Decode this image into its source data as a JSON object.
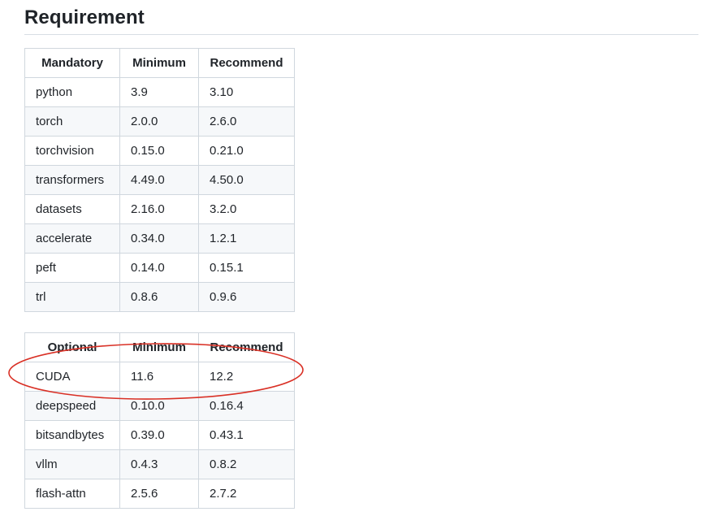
{
  "heading": "Requirement",
  "mandatory": {
    "headers": [
      "Mandatory",
      "Minimum",
      "Recommend"
    ],
    "rows": [
      [
        "python",
        "3.9",
        "3.10"
      ],
      [
        "torch",
        "2.0.0",
        "2.6.0"
      ],
      [
        "torchvision",
        "0.15.0",
        "0.21.0"
      ],
      [
        "transformers",
        "4.49.0",
        "4.50.0"
      ],
      [
        "datasets",
        "2.16.0",
        "3.2.0"
      ],
      [
        "accelerate",
        "0.34.0",
        "1.2.1"
      ],
      [
        "peft",
        "0.14.0",
        "0.15.1"
      ],
      [
        "trl",
        "0.8.6",
        "0.9.6"
      ]
    ]
  },
  "optional": {
    "headers": [
      "Optional",
      "Minimum",
      "Recommend"
    ],
    "rows": [
      [
        "CUDA",
        "11.6",
        "12.2"
      ],
      [
        "deepspeed",
        "0.10.0",
        "0.16.4"
      ],
      [
        "bitsandbytes",
        "0.39.0",
        "0.43.1"
      ],
      [
        "vllm",
        "0.4.3",
        "0.8.2"
      ],
      [
        "flash-attn",
        "2.5.6",
        "2.7.2"
      ]
    ]
  },
  "colors": {
    "highlight": "#d93025",
    "border": "#d0d7de",
    "stripe": "#f6f8fa"
  }
}
